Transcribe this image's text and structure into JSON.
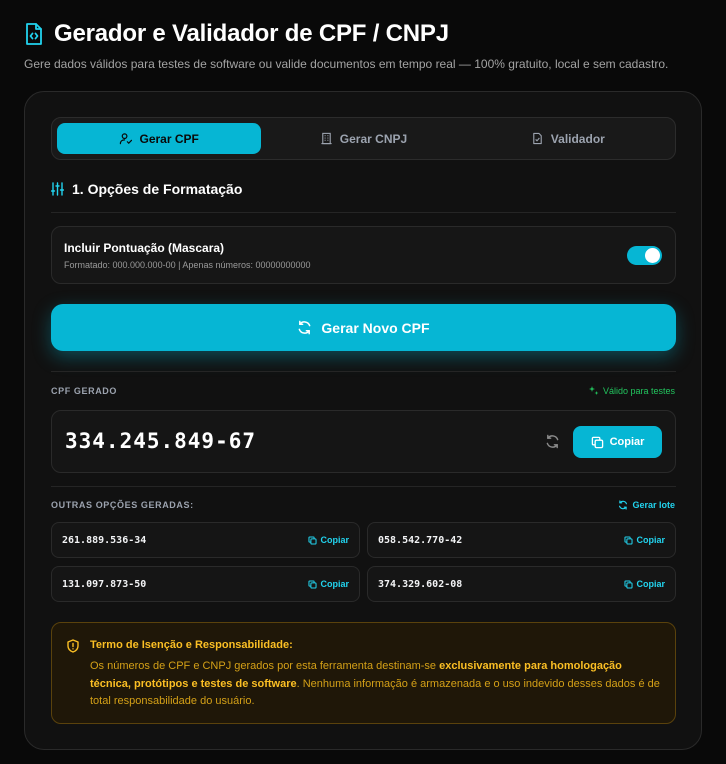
{
  "header": {
    "title": "Gerador e Validador de CPF / CNPJ",
    "subtitle": "Gere dados válidos para testes de software ou valide documentos em tempo real — 100% gratuito, local e sem cadastro."
  },
  "tabs": [
    {
      "label": "Gerar CPF",
      "icon": "user-icon",
      "active": true
    },
    {
      "label": "Gerar CNPJ",
      "icon": "building-icon",
      "active": false
    },
    {
      "label": "Validador",
      "icon": "file-check-icon",
      "active": false
    }
  ],
  "options": {
    "section_title": "1. Opções de Formatação",
    "punctuation_label": "Incluir Pontuação (Mascara)",
    "punctuation_hint": "Formatado: 000.000.000-00 | Apenas números: 00000000000",
    "punctuation_enabled": true
  },
  "generate_button": "Gerar Novo CPF",
  "result": {
    "label": "CPF GERADO",
    "badge": "Válido para testes",
    "value": "334.245.849-67",
    "copy_label": "Copiar"
  },
  "others": {
    "label": "OUTRAS OPÇÕES GERADAS:",
    "batch_label": "Gerar lote",
    "copy_label": "Copiar",
    "items": [
      "261.889.536-34",
      "058.542.770-42",
      "131.097.873-50",
      "374.329.602-08"
    ]
  },
  "disclaimer": {
    "title": "Termo de Isenção e Responsabilidade:",
    "text_1": "Os números de CPF e CNPJ gerados por esta ferramenta destinam-se ",
    "text_bold": "exclusivamente para homologação técnica, protótipos e testes de software",
    "text_2": ". Nenhuma informação é armazenada e o uso indevido desses dados é de total responsabilidade do usuário."
  },
  "colors": {
    "accent": "#06b6d4",
    "background": "#090909",
    "card": "#111111",
    "success": "#22c55e",
    "warning": "#fbbf24"
  }
}
